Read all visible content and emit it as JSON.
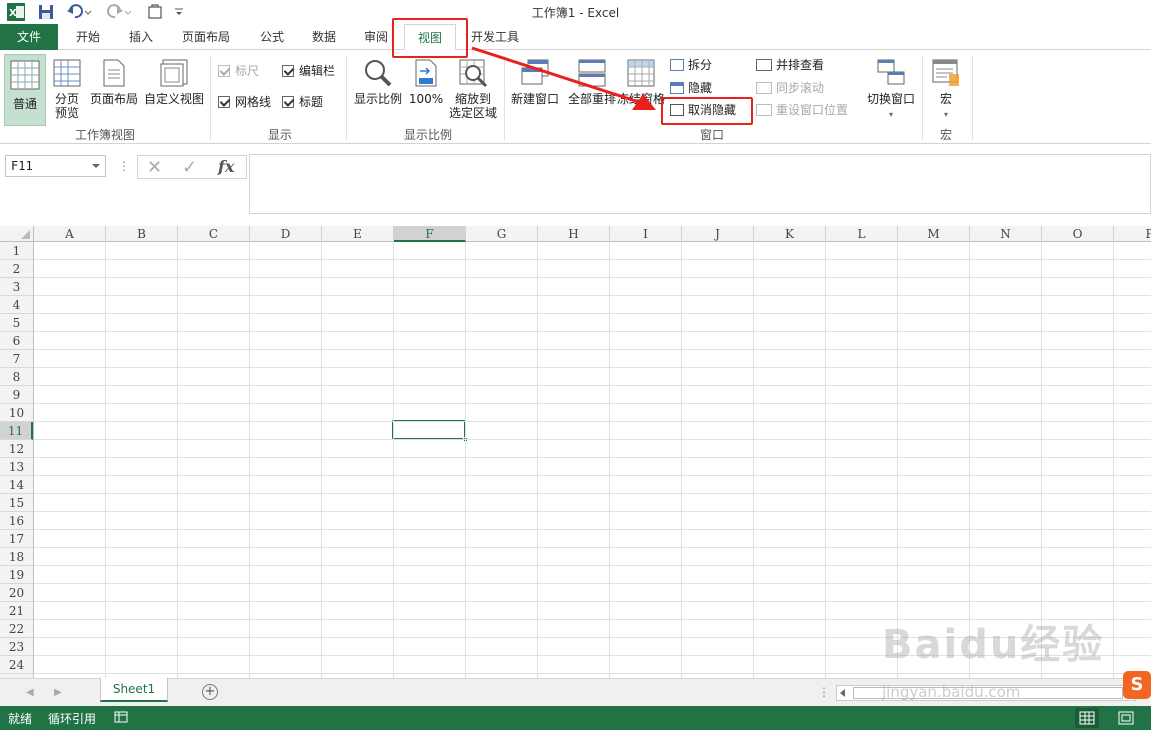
{
  "window": {
    "title": "工作簿1 - Excel"
  },
  "tabs": [
    {
      "label": "文件"
    },
    {
      "label": "开始"
    },
    {
      "label": "插入"
    },
    {
      "label": "页面布局"
    },
    {
      "label": "公式"
    },
    {
      "label": "数据"
    },
    {
      "label": "审阅"
    },
    {
      "label": "视图"
    },
    {
      "label": "开发工具"
    }
  ],
  "ribbon": {
    "workbook_views": {
      "label": "工作簿视图",
      "normal": "普通",
      "page_break_1": "分页",
      "page_break_2": "预览",
      "page_layout": "页面布局",
      "custom_views": "自定义视图"
    },
    "show": {
      "label": "显示",
      "ruler": "标尺",
      "formula_bar": "编辑栏",
      "gridlines": "网格线",
      "headings": "标题"
    },
    "zoom": {
      "label": "显示比例",
      "zoom": "显示比例",
      "zoom_100": "100%",
      "zoom_sel_1": "缩放到",
      "zoom_sel_2": "选定区域"
    },
    "window": {
      "label": "窗口",
      "new_window": "新建窗口",
      "arrange_all": "全部重排",
      "freeze": "冻结窗格",
      "split": "拆分",
      "hide": "隐藏",
      "unhide": "取消隐藏",
      "side_by_side": "并排查看",
      "sync_scroll": "同步滚动",
      "reset_pos": "重设窗口位置",
      "switch": "切换窗口"
    },
    "macros": {
      "label": "宏",
      "macros": "宏"
    }
  },
  "formula_bar": {
    "name_box": "F11",
    "fx": "fx"
  },
  "grid": {
    "columns": [
      "A",
      "B",
      "C",
      "D",
      "E",
      "F",
      "G",
      "H",
      "I",
      "J",
      "K",
      "L",
      "M",
      "N",
      "O",
      "P"
    ],
    "rows": [
      "1",
      "2",
      "3",
      "4",
      "5",
      "6",
      "7",
      "8",
      "9",
      "10",
      "11",
      "12",
      "13",
      "14",
      "15",
      "16",
      "17",
      "18",
      "19",
      "20",
      "21",
      "22",
      "23",
      "24"
    ],
    "selected_column": "F",
    "selected_row": "11"
  },
  "sheets": {
    "active": "Sheet1"
  },
  "status": {
    "ready": "就绪",
    "circular": "循环引用"
  },
  "watermark": {
    "brand": "Baidu经验",
    "url": "jingyan.baidu.com",
    "ime": "S"
  },
  "colors": {
    "excel_green": "#217346",
    "annotation_red": "#e8221a"
  }
}
